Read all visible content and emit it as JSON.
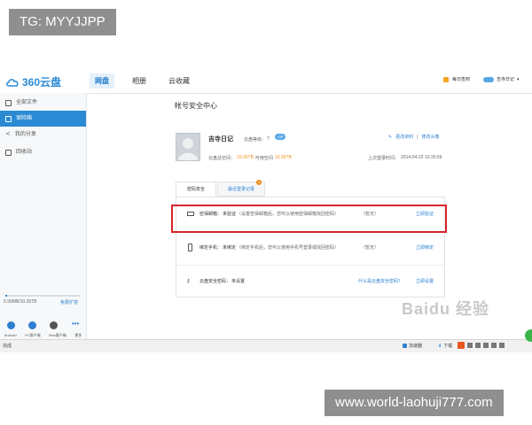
{
  "watermark_top": "TG: MYYJJPP",
  "watermark_bottom": "www.world-laohuji777.com",
  "app": {
    "logo_text": "360云盘",
    "tabs": [
      "网盘",
      "相册",
      "云收藏"
    ],
    "header_right": {
      "checkin": "每日签到",
      "user": "吉寺日记"
    }
  },
  "sidebar": {
    "items": [
      "全部文件",
      "保险箱",
      "我的分享",
      "回收站"
    ],
    "storage": "5.90MB/10.35TB",
    "expand_link": "免费扩容",
    "clients": [
      "Android",
      "PC客户端",
      "Mac客户端",
      "更多"
    ]
  },
  "main": {
    "page_title": "帐号安全中心",
    "profile": {
      "name": "吉寺日记",
      "level_label": "云盘等级：",
      "level": "7",
      "vip_badge": "VIP",
      "edit_info": "更改资料",
      "edit_avatar": "修改头像",
      "space_label": "云盘总空间：",
      "space_total": "10.35TB",
      "used_label": "可用空间",
      "space_free": "10.35TB",
      "last_login_label": "上次登录时间：",
      "last_login": "2014-04-22 10:30:59"
    },
    "tabs": [
      "密码安全",
      "最近登录记录"
    ],
    "tab_badge": "1",
    "rows": [
      {
        "label": "密保邮箱：",
        "status": "未验证",
        "desc": "（设置密保邮箱后，您可以使用密保邮箱找回密码）",
        "level": "（暂无）",
        "link_left": "",
        "action": "立即验证",
        "icon": "mail-icon"
      },
      {
        "label": "绑定手机：",
        "status": "未绑定",
        "desc": "（绑定手机后，您可以使用手机号登录或找回密码）",
        "level": "（暂无）",
        "link_left": "",
        "action": "立即绑定",
        "icon": "phone-icon"
      },
      {
        "label": "云盘安全密码：",
        "status": "未设置",
        "desc": "",
        "level": "",
        "link_left": "什么是云盘安全密码？",
        "action": "立即设置",
        "icon": "key-icon"
      }
    ],
    "highlight_color": "#d6242c"
  },
  "statusbar": {
    "left": "完成",
    "speed": "加速器",
    "download": "下载"
  }
}
